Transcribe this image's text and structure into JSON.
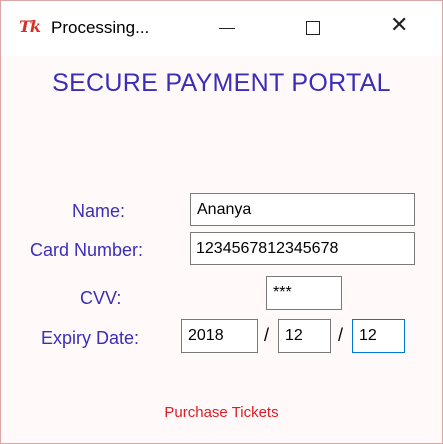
{
  "window": {
    "title": "Processing...",
    "icon": "tk-feather-icon",
    "controls": [
      "minimize",
      "maximize",
      "close"
    ],
    "close_glyph": "✕"
  },
  "heading": "SECURE PAYMENT PORTAL",
  "form": {
    "name_label": "Name:",
    "name_value": "Ananya",
    "card_label": "Card Number:",
    "card_value": "1234567812345678",
    "cvv_label": "CVV:",
    "cvv_value": "***",
    "expiry_label": "Expiry Date:",
    "expiry_year": "2018",
    "expiry_month": "12",
    "expiry_day": "12",
    "separator": "/"
  },
  "purchase_label": "Purchase Tickets",
  "colors": {
    "label_text": "#3a2eb8",
    "purchase_text": "#e01b24",
    "background": "#fff9fa",
    "focus_border": "#0078d7"
  }
}
